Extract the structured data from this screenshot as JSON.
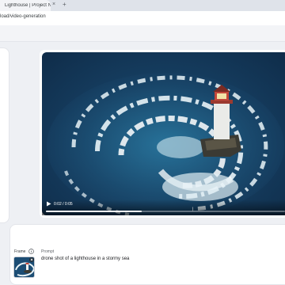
{
  "browser": {
    "tab_title": "Lighthouse | Project Nex (B...",
    "tab_close": "×",
    "new_tab": "+",
    "url": "load/video-generation"
  },
  "player": {
    "time": "0:02 / 0:05",
    "progress": 0.4,
    "icon": "play-icon"
  },
  "input": {
    "frame_label": "Frame",
    "prompt_label": "Prompt",
    "prompt_value": "drone shot of a lighthouse in a stormy sea",
    "info_icon": "info-icon",
    "thumbnail_close_icon": "close-icon"
  },
  "colors": {
    "page_bg": "#eef0f4",
    "sea_deep": "#0f2c49",
    "sea_mid": "#1f5f84",
    "foam": "#e9f3f7",
    "lighthouse_red": "#c2473a"
  }
}
